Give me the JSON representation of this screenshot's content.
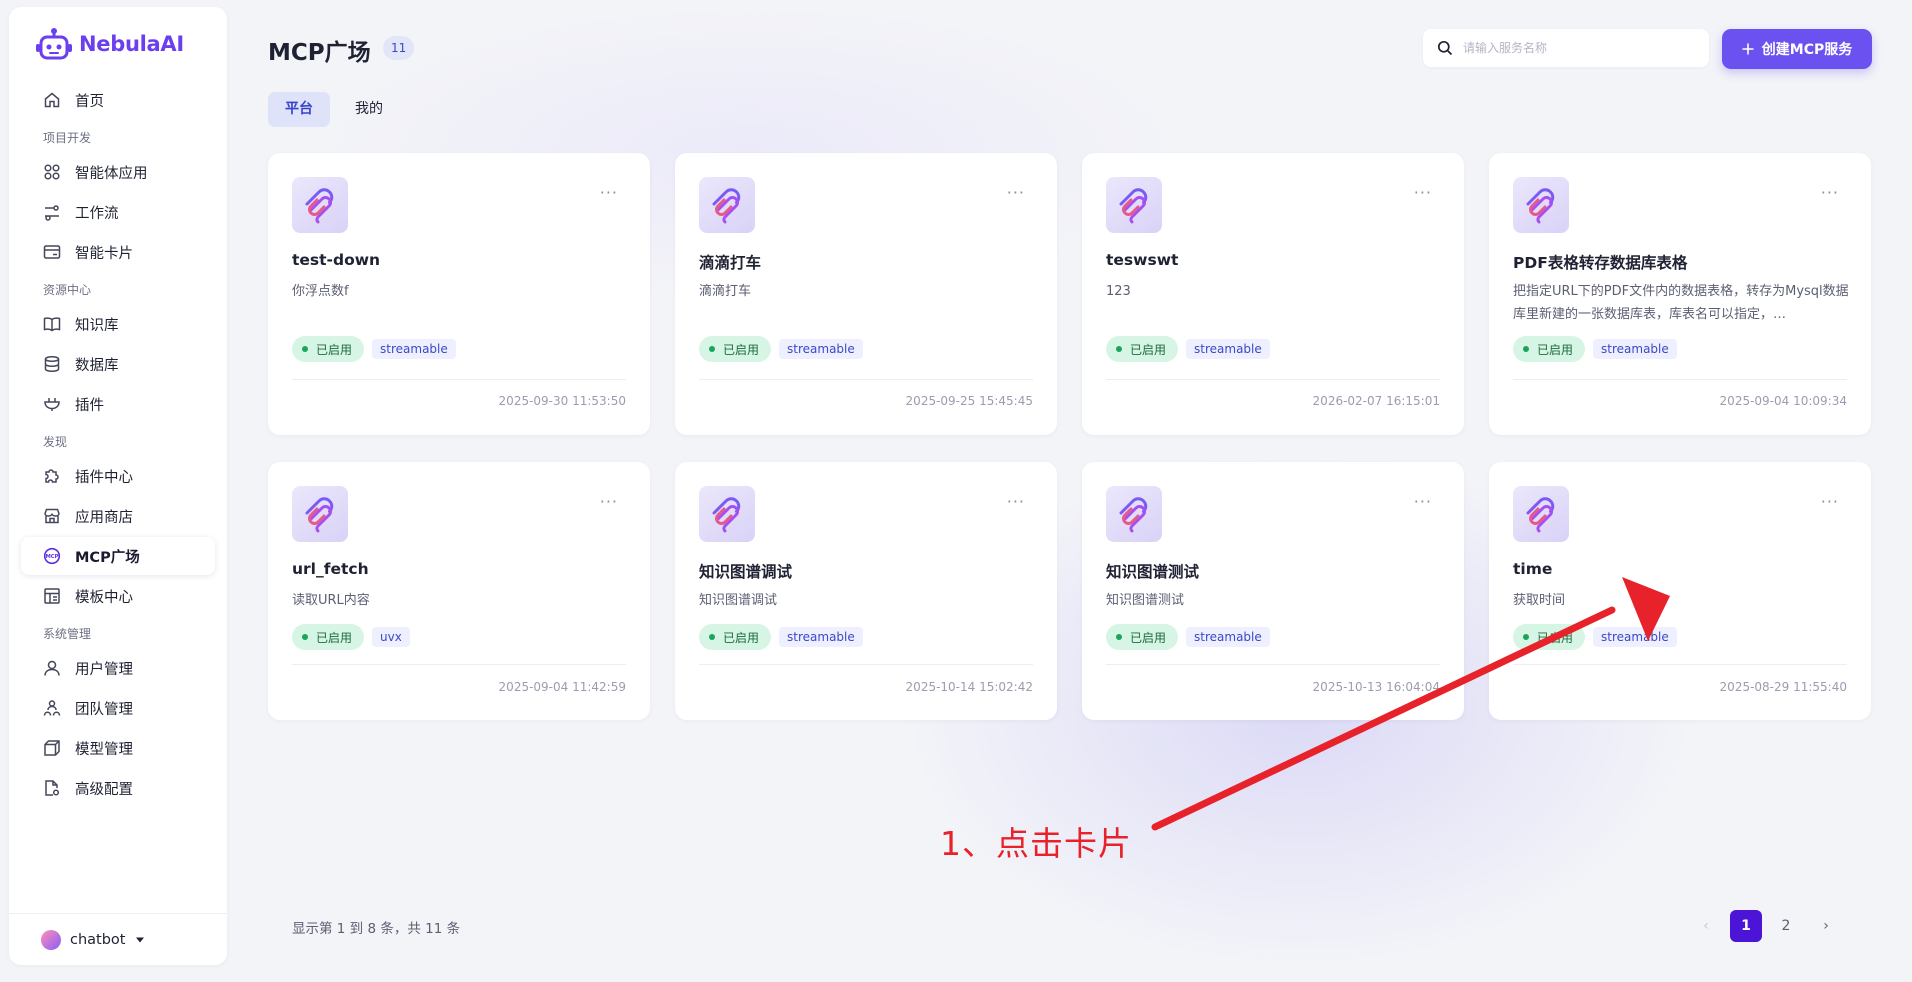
{
  "brand": {
    "name": "NebulaAI"
  },
  "sidebar": {
    "home": "首页",
    "groups": [
      {
        "label": "项目开发",
        "items": [
          {
            "label": "智能体应用",
            "icon": "apps-grid-icon"
          },
          {
            "label": "工作流",
            "icon": "workflow-icon"
          },
          {
            "label": "智能卡片",
            "icon": "card-icon"
          }
        ]
      },
      {
        "label": "资源中心",
        "items": [
          {
            "label": "知识库",
            "icon": "book-icon"
          },
          {
            "label": "数据库",
            "icon": "database-icon"
          },
          {
            "label": "插件",
            "icon": "plug-icon"
          }
        ]
      },
      {
        "label": "发现",
        "items": [
          {
            "label": "插件中心",
            "icon": "puzzle-icon"
          },
          {
            "label": "应用商店",
            "icon": "store-icon"
          },
          {
            "label": "MCP广场",
            "icon": "mcp-icon",
            "active": true
          },
          {
            "label": "模板中心",
            "icon": "template-icon"
          }
        ]
      },
      {
        "label": "系统管理",
        "items": [
          {
            "label": "用户管理",
            "icon": "user-icon"
          },
          {
            "label": "团队管理",
            "icon": "team-icon"
          },
          {
            "label": "模型管理",
            "icon": "cube-icon"
          },
          {
            "label": "高级配置",
            "icon": "settings-file-icon"
          }
        ]
      }
    ],
    "user": "chatbot"
  },
  "header": {
    "title": "MCP广场",
    "count": "11",
    "search_placeholder": "请输入服务名称",
    "create_label": "创建MCP服务"
  },
  "tabs": [
    {
      "label": "平台",
      "active": true
    },
    {
      "label": "我的",
      "active": false
    }
  ],
  "cards": [
    {
      "title": "test-down",
      "desc": "你浮点数f",
      "status": "已启用",
      "protocol": "streamable",
      "time": "2025-09-30 11:53:50"
    },
    {
      "title": "滴滴打车",
      "desc": "滴滴打车",
      "status": "已启用",
      "protocol": "streamable",
      "time": "2025-09-25 15:45:45"
    },
    {
      "title": "teswswt",
      "desc": "123",
      "status": "已启用",
      "protocol": "streamable",
      "time": "2026-02-07 16:15:01"
    },
    {
      "title": "PDF表格转存数据库表格",
      "desc": "把指定URL下的PDF文件内的数据表格，转存为Mysql数据库里新建的一张数据库表，库表名可以指定，…",
      "status": "已启用",
      "protocol": "streamable",
      "time": "2025-09-04 10:09:34"
    },
    {
      "title": "url_fetch",
      "desc": "读取URL内容",
      "status": "已启用",
      "protocol": "uvx",
      "time": "2025-09-04 11:42:59"
    },
    {
      "title": "知识图谱调试",
      "desc": "知识图谱调试",
      "status": "已启用",
      "protocol": "streamable",
      "time": "2025-10-14 15:02:42"
    },
    {
      "title": "知识图谱测试",
      "desc": "知识图谱测试",
      "status": "已启用",
      "protocol": "streamable",
      "time": "2025-10-13 16:04:04"
    },
    {
      "title": "time",
      "desc": "获取时间",
      "status": "已启用",
      "protocol": "streamable",
      "time": "2025-08-29 11:55:40"
    }
  ],
  "annotation": {
    "text": "1、点击卡片",
    "color": "#e8222a"
  },
  "pagination": {
    "info": "显示第 1 到 8 条，共 11 条",
    "pages": [
      "1",
      "2"
    ],
    "current": "1",
    "prev": "‹",
    "next": "›"
  },
  "colors": {
    "accent": "#6b52f0",
    "active_page": "#4c14d6",
    "status_green": "#1aa55a"
  }
}
